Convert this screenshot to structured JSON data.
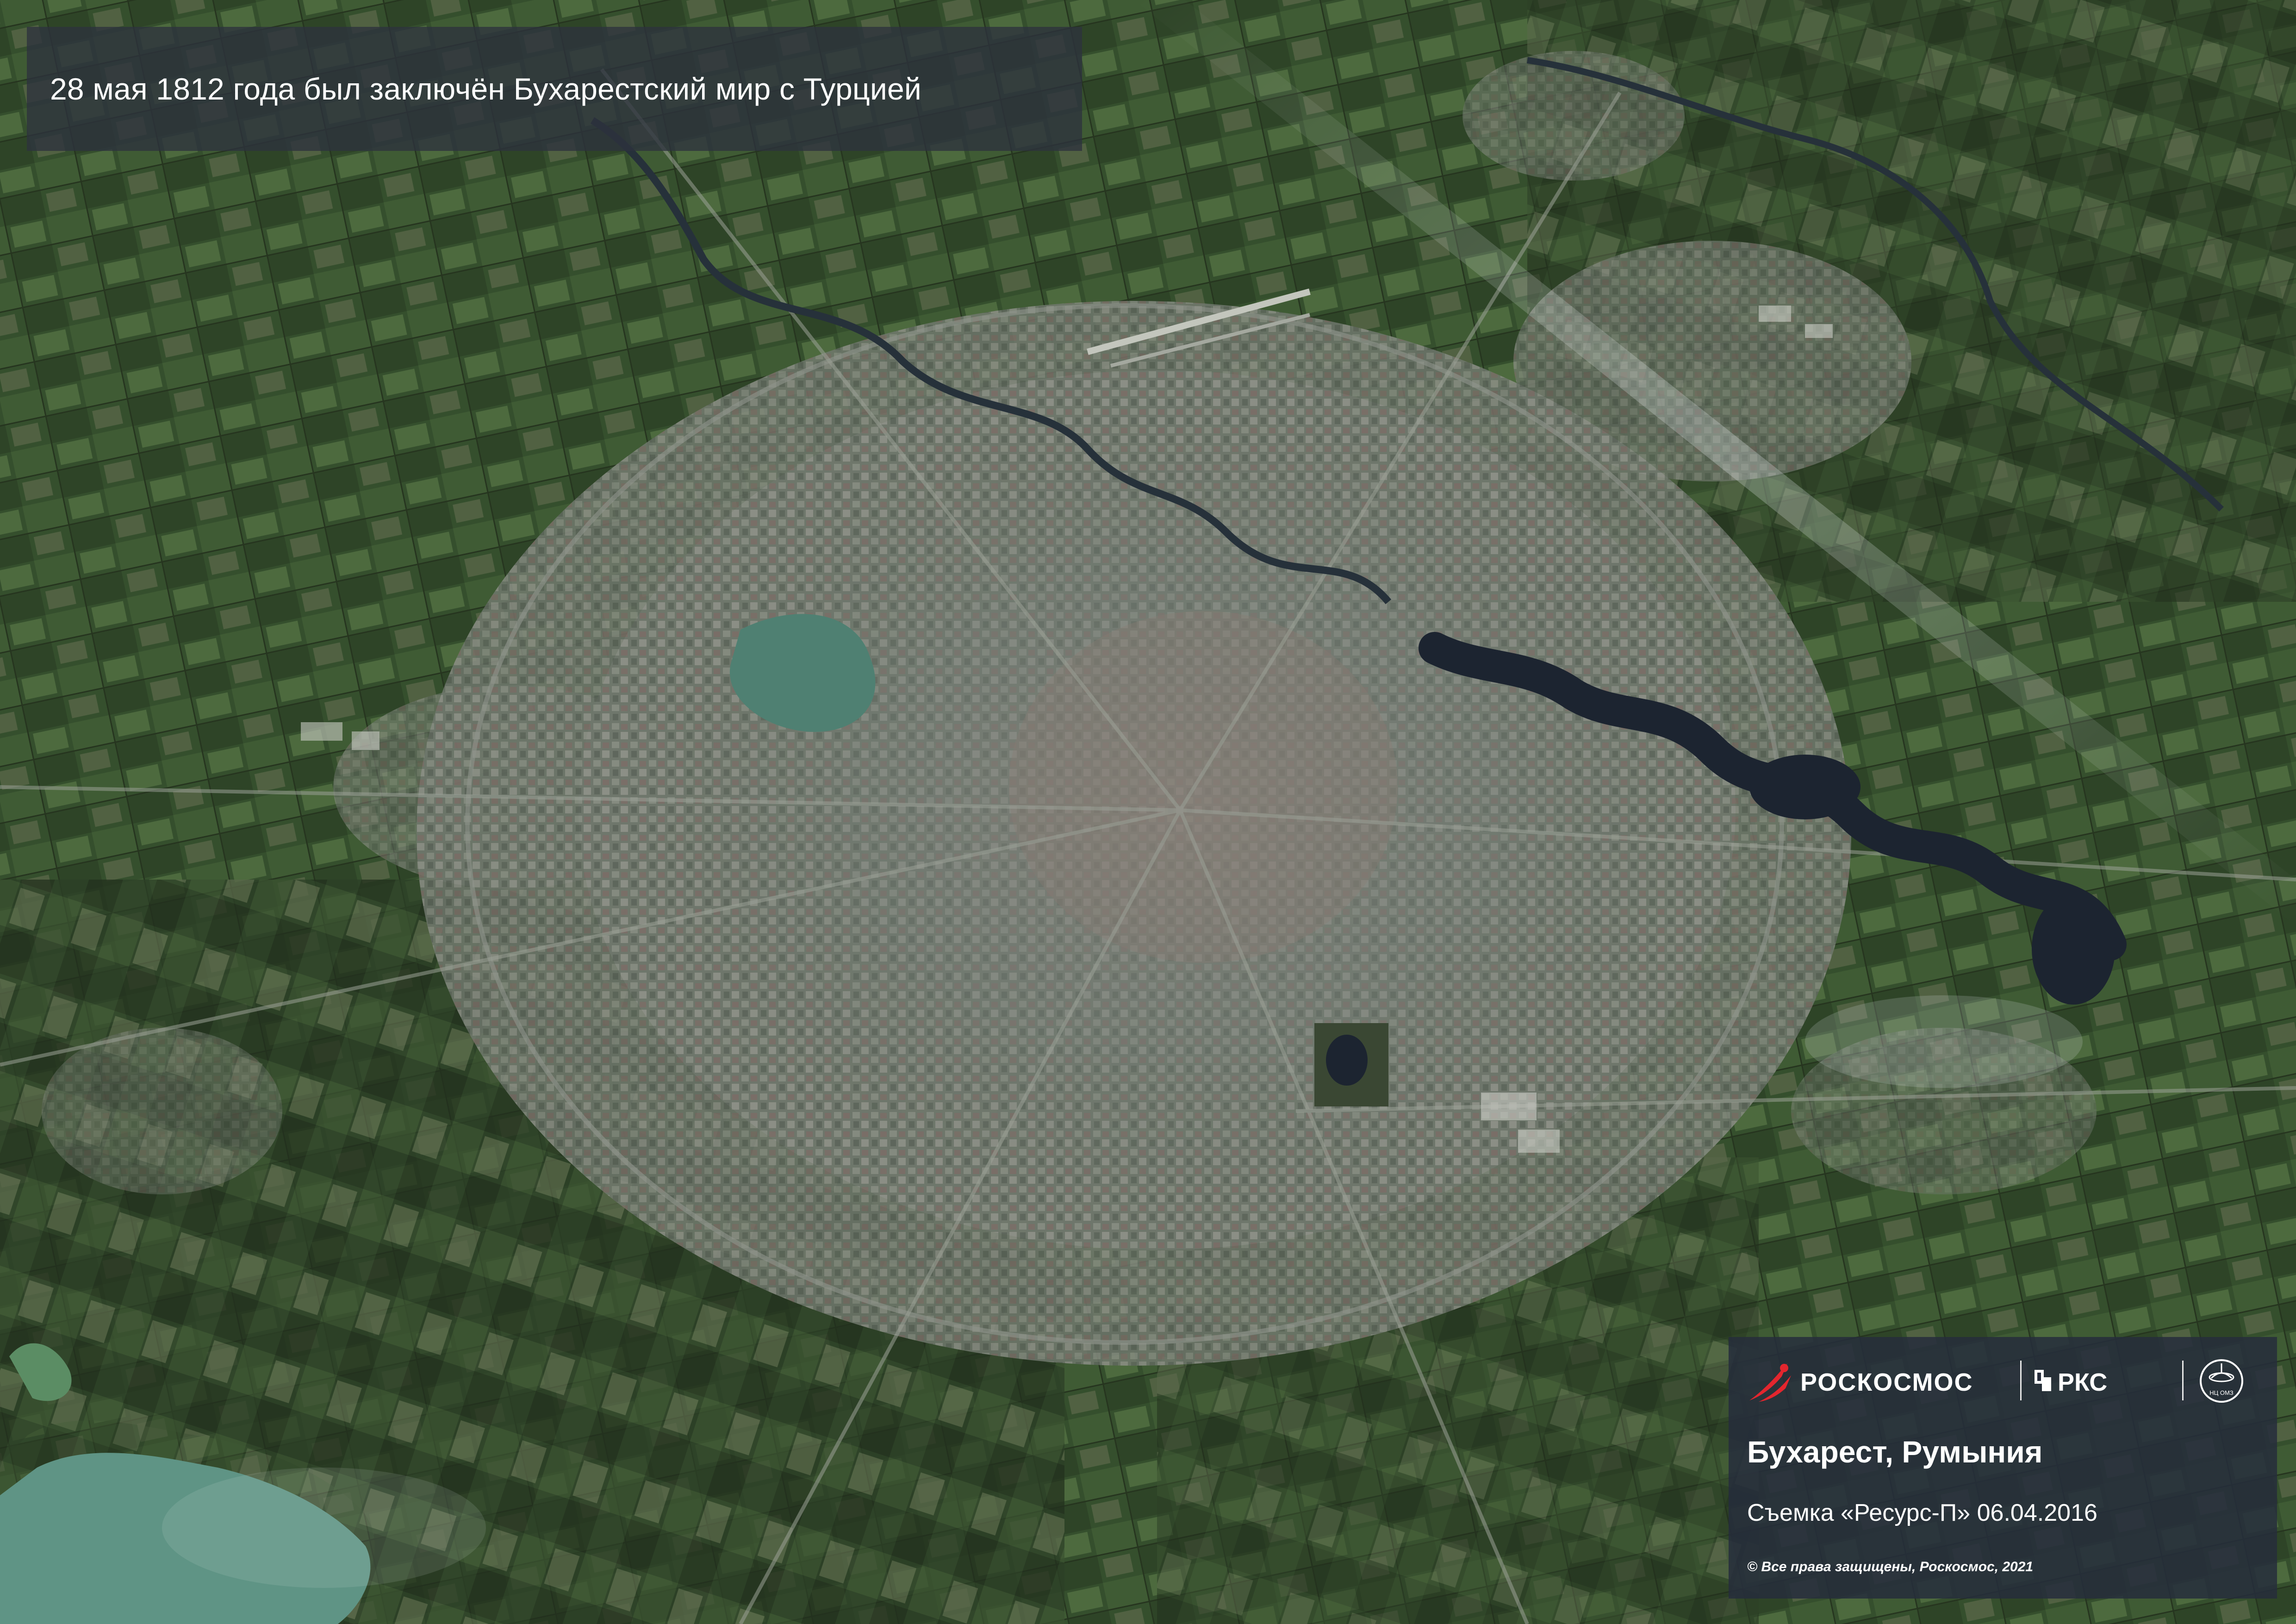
{
  "header": {
    "title": "28 мая 1812 года был заключён Бухарестский мир с Турцией"
  },
  "branding": {
    "roscosmos": "РОСКОСМОС",
    "rks": "РКС",
    "emblem_caption": "НЦ ОМЗ"
  },
  "caption": {
    "place": "Бухарест, Румыния",
    "capture": "Съемка «Ресурс-П» 06.04.2016",
    "copyright": "© Все права защищены, Роскосмос, 2021"
  },
  "colors": {
    "rocket_red": "#e3262e",
    "panel_bg": "#262d3c",
    "field_green": "#3b5631",
    "urban_grey": "#7d8579",
    "water_dark": "#1c2430",
    "lake_teal": "#5f9485"
  }
}
